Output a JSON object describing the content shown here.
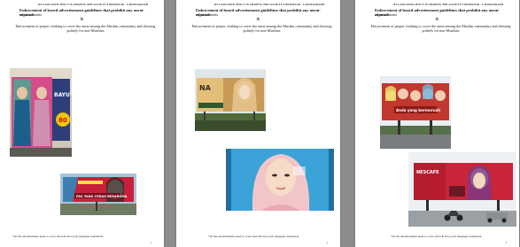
{
  "pages": [
    {
      "header": "BY-LAWS EFFICIENCY IN SHAPING THE SOCIETY'S BEHAVIOR - A MONOGRAPH",
      "title_line1": "Enforcement of board advertisement guidelines that prohibit any aurat-exposed",
      "title_line2": "advertisements",
      "amp": "&",
      "body": "Enforcement of proper clothing to cover the aurat among the Muslim community and dressing politely for non-Muslims",
      "caption": "*all the advertisement need to cover aurat & have jawi language translation",
      "page_number": "1",
      "photos": [
        {
          "name": "billboard-women-photo",
          "sign_text": "BAYU",
          "price": "80",
          "colors": {
            "sky": "#d8d0c4",
            "board": "#d64b8a",
            "frame": "#2a2a2a"
          }
        },
        {
          "name": "billboard-jawi-banner-photo",
          "sign_text": "PAS YANG CERAH BERAROMA",
          "colors": {
            "sky": "#a8c4da",
            "board": "#c8203a",
            "frame": "#333333"
          }
        }
      ]
    },
    {
      "header": "BY-LAWS EFFICIENCY IN SHAPING THE SOCIETY'S BEHAVIOR - A MONOGRAPH",
      "title_line1": "Enforcement of board advertisement guidelines that prohibit any aurat-exposed",
      "title_line2": "advertisements",
      "amp": "&",
      "body": "Enforcement of proper clothing to cover the aurat among the Muslim community and dressing politely for non-Muslims",
      "caption": "*all the advertisement need to cover aurat & have jawi language translation",
      "page_number": "2",
      "photos": [
        {
          "name": "roadside-billboard-photo",
          "sign_text": "NA",
          "colors": {
            "sky": "#dfe6e9",
            "board": "#c99a56",
            "frame": "#3a3a3a"
          }
        },
        {
          "name": "hijab-advertisement-photo",
          "colors": {
            "bg": "#3ba3d8",
            "scarf": "#f2c6c8",
            "face": "#f6dcc6"
          }
        }
      ]
    },
    {
      "header": "BY-LAWS EFFICIENCY IN SHAPING THE SOCIETY'S BEHAVIOR - A MONOGRAPH",
      "title_line1": "Enforcement of board advertisement guidelines that prohibit any aurat-exposed",
      "title_line2": "advertisements",
      "amp": "&",
      "body": "Enforcement of proper clothing to cover the aurat among the Muslim community and dressing politely for non-Muslims",
      "caption": "*all the advertisement need to cover aurat & have jawi language translation",
      "page_number": "3",
      "photos": [
        {
          "name": "highway-billboard-photo",
          "sign_text": "Anda yang bermaruah",
          "colors": {
            "sky": "#e8eef2",
            "board": "#c2372f",
            "frame": "#2f2f2f"
          }
        },
        {
          "name": "street-billboard-photo",
          "sign_text": "NESCAFE",
          "colors": {
            "sky": "#eef1f3",
            "board": "#c8253a",
            "frame": "#2b2b2b"
          }
        }
      ]
    }
  ]
}
